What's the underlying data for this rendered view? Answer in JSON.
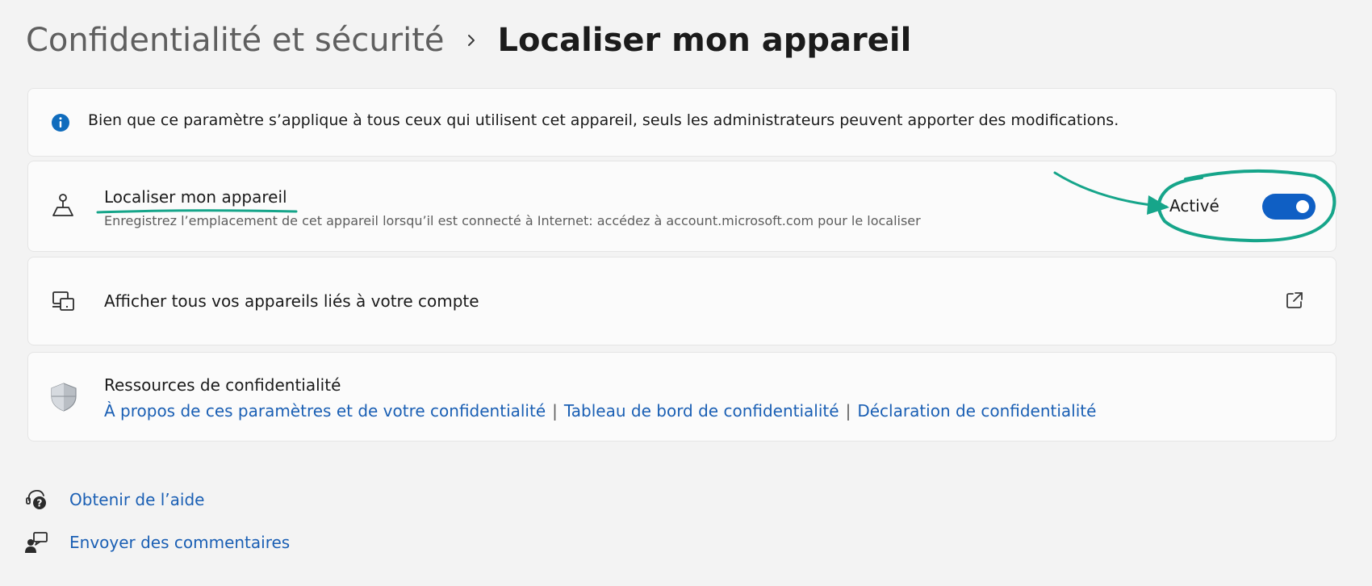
{
  "header": {
    "parent": "Confidentialité et sécurité",
    "current": "Localiser mon appareil"
  },
  "info_banner": {
    "icon": "info-icon",
    "text": "Bien que ce paramètre s’applique à tous ceux qui utilisent cet appareil, seuls les administrateurs peuvent apporter des modifications."
  },
  "locate_setting": {
    "icon": "person-location-icon",
    "title": "Localiser mon appareil",
    "description": "Enregistrez l’emplacement de cet appareil lorsqu’il est connecté à Internet: accédez à account.microsoft.com pour le localiser",
    "toggle_label": "Activé",
    "toggle_on": true
  },
  "devices_link": {
    "icon": "devices-icon",
    "label": "Afficher tous vos appareils liés à votre compte",
    "trailing_icon": "open-external-icon"
  },
  "privacy_resources": {
    "icon": "shield-icon",
    "title": "Ressources de confidentialité",
    "links": [
      "À propos de ces paramètres et de votre confidentialité",
      "Tableau de bord de confidentialité",
      "Déclaration de confidentialité"
    ],
    "separator": "|"
  },
  "footer": {
    "help": "Obtenir de l’aide",
    "feedback": "Envoyer des commentaires"
  },
  "colors": {
    "accent": "#0f5fc4",
    "link": "#1a5fb4",
    "annotation": "#16a58a",
    "background": "#f3f3f3",
    "card": "#fbfbfb"
  }
}
